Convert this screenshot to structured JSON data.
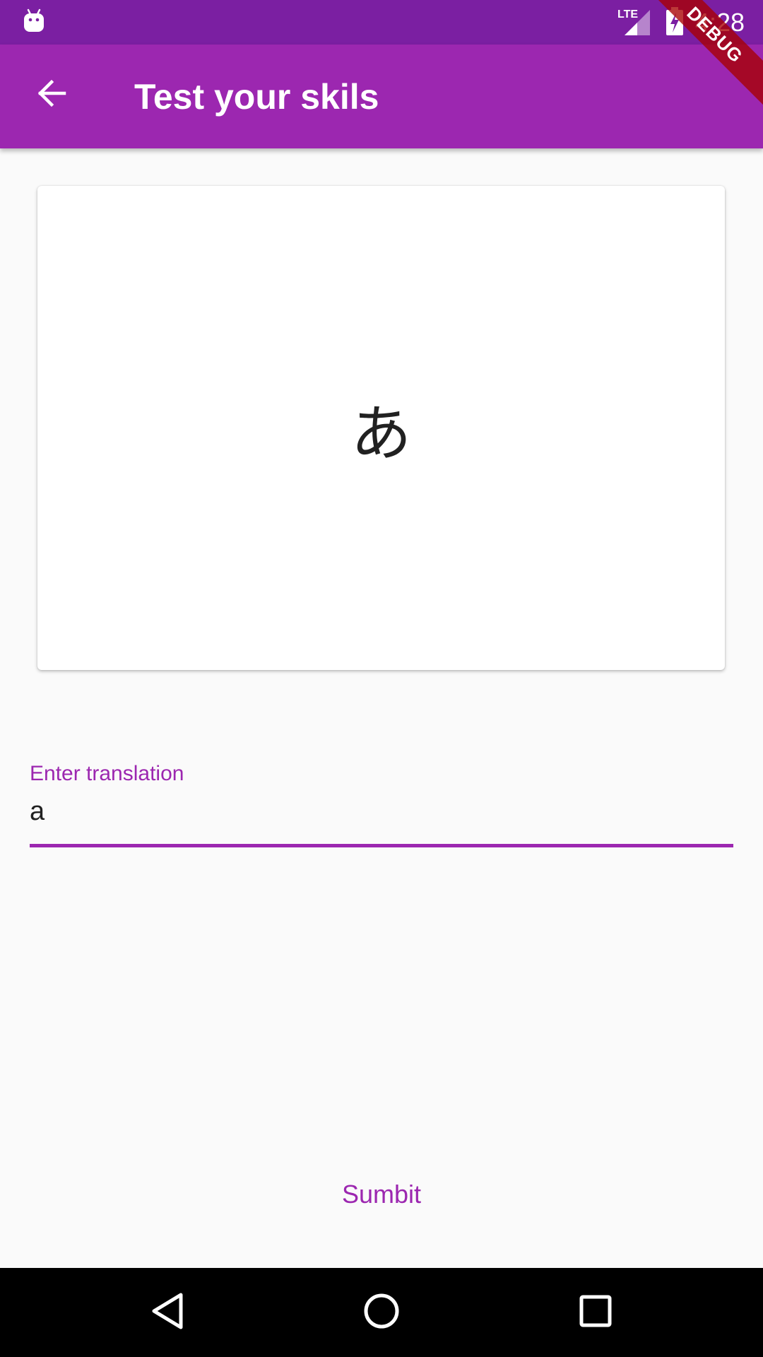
{
  "status_bar": {
    "time": "4:28",
    "network": "LTE",
    "icons": [
      "android-icon",
      "lte-signal-icon",
      "battery-charging-icon"
    ]
  },
  "debug_banner": {
    "label": "DEBUG"
  },
  "app_bar": {
    "title": "Test your skils",
    "back_icon": "arrow-back-icon",
    "color": "#9c27b0"
  },
  "card": {
    "character": "あ"
  },
  "translation_field": {
    "label": "Enter translation",
    "value": "a"
  },
  "submit": {
    "label": "Sumbit"
  },
  "nav_bar": {
    "buttons": [
      "back-triangle-icon",
      "home-circle-icon",
      "recents-square-icon"
    ]
  }
}
